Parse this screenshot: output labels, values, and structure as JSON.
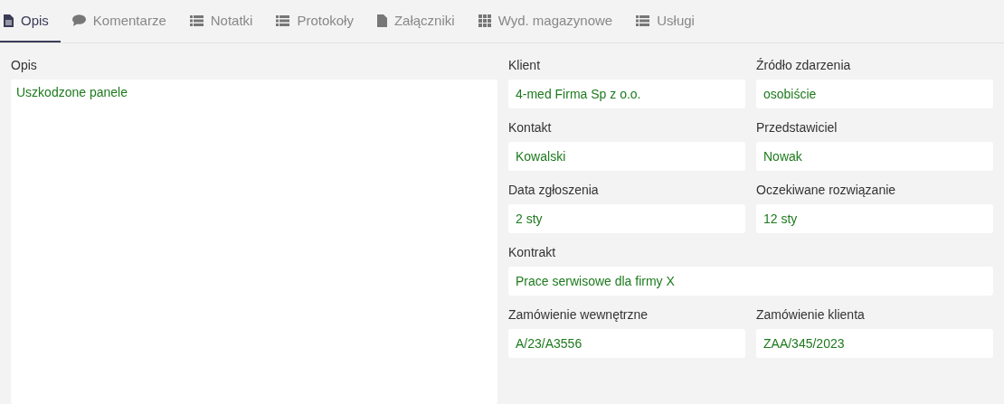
{
  "tabs": [
    {
      "label": "Opis",
      "kind": "doc",
      "selected": true
    },
    {
      "label": "Komentarze",
      "kind": "comment",
      "selected": false
    },
    {
      "label": "Notatki",
      "kind": "list",
      "selected": false
    },
    {
      "label": "Protokoły",
      "kind": "list",
      "selected": false
    },
    {
      "label": "Załączniki",
      "kind": "file",
      "selected": false
    },
    {
      "label": "Wyd. magazynowe",
      "kind": "grid",
      "selected": false
    },
    {
      "label": "Usługi",
      "kind": "list",
      "selected": false
    }
  ],
  "description": {
    "label": "Opis",
    "value": "Uszkodzone panele"
  },
  "fields": [
    {
      "label": "Klient",
      "value": "4-med Firma Sp z o.o.",
      "kind": "half"
    },
    {
      "label": "Źródło zdarzenia",
      "value": "osobiście",
      "kind": "half"
    },
    {
      "label": "Kontakt",
      "value": "Kowalski",
      "kind": "half"
    },
    {
      "label": "Przedstawiciel",
      "value": "Nowak",
      "kind": "half"
    },
    {
      "label": "Data zgłoszenia",
      "value": "2 sty",
      "kind": "half"
    },
    {
      "label": "Oczekiwane rozwiązanie",
      "value": "12 sty",
      "kind": "half"
    },
    {
      "label": "Kontrakt",
      "value": "Prace serwisowe dla firmy X",
      "kind": "wide"
    },
    {
      "label": "Zamówienie wewnętrzne",
      "value": "A/23/A3556",
      "kind": "half"
    },
    {
      "label": "Zamówienie klienta",
      "value": "ZAA/345/2023",
      "kind": "half"
    }
  ]
}
